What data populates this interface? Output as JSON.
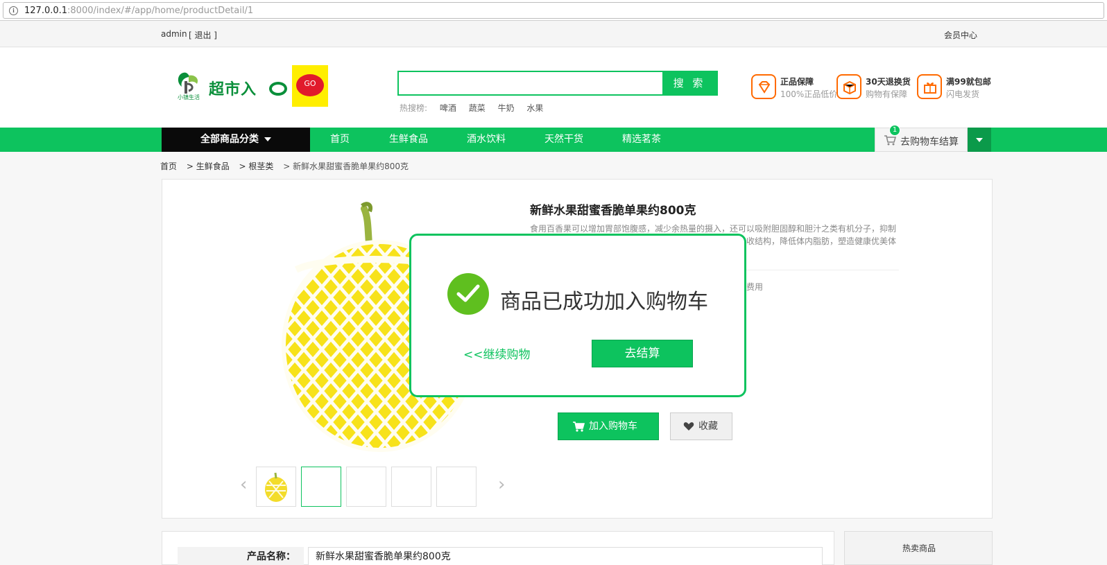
{
  "browser": {
    "url_host": "127.0.0.1",
    "url_rest": ":8000/index/#/app/home/productDetail/1"
  },
  "topbar": {
    "user": "admin",
    "logout": "[ 退出 ]",
    "member_center": "会员中心"
  },
  "header": {
    "logo_brand": "小镇生活",
    "logo_text": "超市入",
    "logo_go": "GO",
    "search_placeholder": "",
    "search_button": "搜 索",
    "hot_label": "热搜榜:",
    "hot_keywords": [
      "啤酒",
      "蔬菜",
      "牛奶",
      "水果"
    ],
    "promises": [
      {
        "title": "正品保障",
        "subtitle": "100%正品低价",
        "icon": "diamond-icon"
      },
      {
        "title": "30天退换货",
        "subtitle": "购物有保障",
        "icon": "box-icon"
      },
      {
        "title": "满99就包邮",
        "subtitle": "闪电发货",
        "icon": "gift-icon"
      }
    ]
  },
  "nav": {
    "all_categories": "全部商品分类",
    "items": [
      "首页",
      "生鲜食品",
      "酒水饮料",
      "天然干货",
      "精选茗茶"
    ],
    "cart_label": "去购物车结算",
    "cart_count": "1"
  },
  "breadcrumb": {
    "items": [
      "首页",
      "> 生鲜食品",
      "> 根茎类",
      "> 新鲜水果甜蜜香脆单果约800克"
    ]
  },
  "product": {
    "title": "新鲜水果甜蜜香脆单果约800克",
    "description": "食用百香果可以增加胃部饱腹感，减少余热量的摄入，还可以吸附胆固醇和胆汁之类有机分子，抑制人体对脂肪的吸收。因此，长期食用有利于改善人体营养吸收结构，降低体内脂肪，塑造健康优美体态。",
    "fee_text": "送费用",
    "add_to_cart": "加入购物车",
    "favorite": "收藏",
    "spec_key": "产品名称：",
    "spec_value": "新鲜水果甜蜜香脆单果约800克",
    "hot_products": "热卖商品"
  },
  "modal": {
    "message": "商品已成功加入购物车",
    "continue": "<<继续购物",
    "checkout": "去结算"
  },
  "colors": {
    "brand_green": "#0dc35e",
    "accent_orange": "#ff6a00"
  }
}
